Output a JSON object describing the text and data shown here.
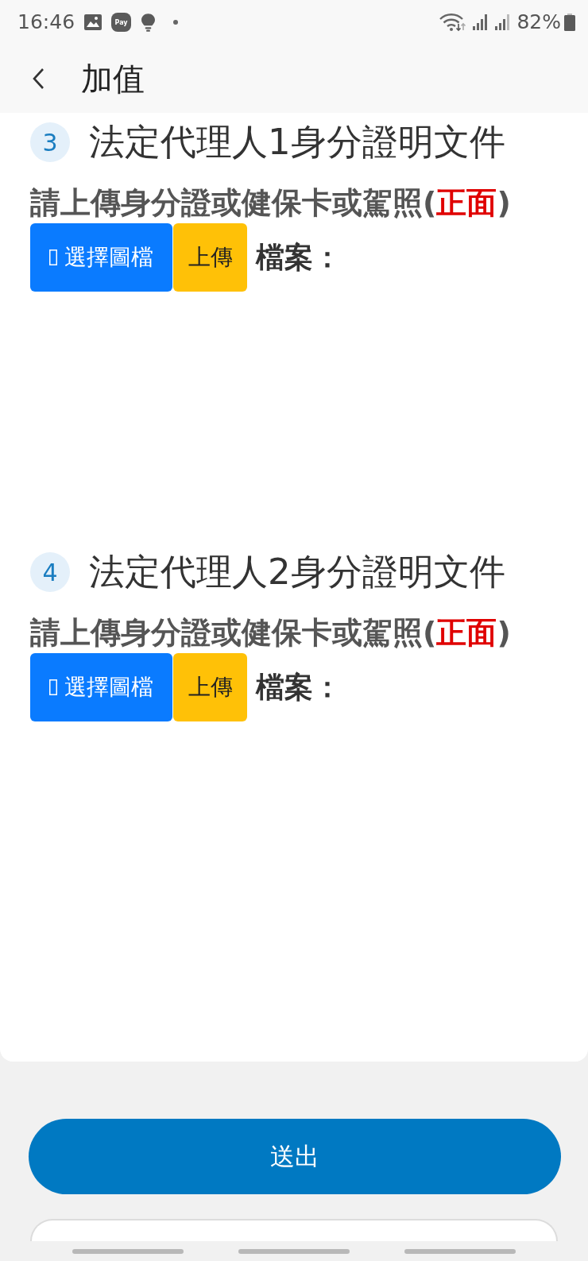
{
  "status_bar": {
    "time": "16:46",
    "app_badge": "Pay",
    "battery": "82%"
  },
  "app_bar": {
    "title": "加值"
  },
  "sections": [
    {
      "number": "3",
      "title": "法定代理人1身分證明文件",
      "instruction": {
        "before": "請上傳身分證或健保卡或駕照(",
        "emphasis": "正面",
        "after": ")"
      },
      "choose_button": "選擇圖檔",
      "upload_button": "上傳",
      "file_label": "檔案："
    },
    {
      "number": "4",
      "title": "法定代理人2身分證明文件",
      "instruction": {
        "before": "請上傳身分證或健保卡或駕照(",
        "emphasis": "正面",
        "after": ")"
      },
      "choose_button": "選擇圖檔",
      "upload_button": "上傳",
      "file_label": "檔案："
    }
  ],
  "submit_button": "送出"
}
